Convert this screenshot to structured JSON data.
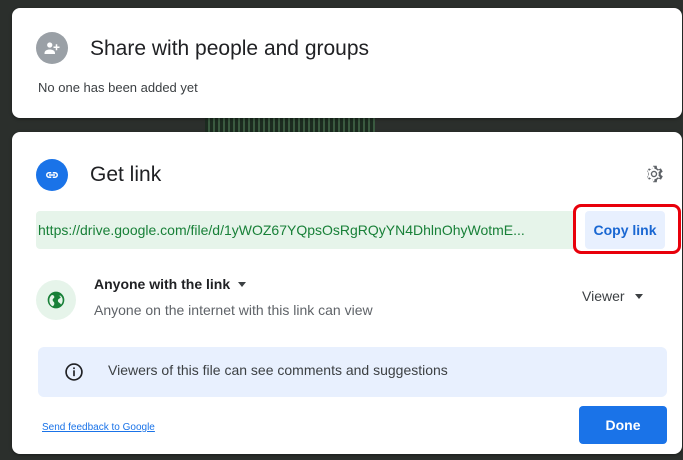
{
  "share_panel": {
    "title": "Share with people and groups",
    "empty_text": "No one has been added yet",
    "icon": "person-add-icon"
  },
  "link_panel": {
    "title": "Get link",
    "icon": "link-icon",
    "settings_icon": "gear-icon",
    "url": "https://drive.google.com/file/d/1yWOZ67YQpsOsRgRQyYN4DhlnOhyWotmE...",
    "copy_label": "Copy link",
    "access": {
      "label": "Anyone with the link",
      "description": "Anyone on the internet with this link can view",
      "icon": "globe-icon"
    },
    "role": "Viewer",
    "info": {
      "text": "Viewers of this file can see comments and suggestions",
      "icon": "info-icon"
    },
    "feedback_link": "Send feedback to Google",
    "done_label": "Done"
  },
  "colors": {
    "accent": "#1a73e8",
    "link_green": "#188038",
    "highlight": "#e8000b"
  }
}
